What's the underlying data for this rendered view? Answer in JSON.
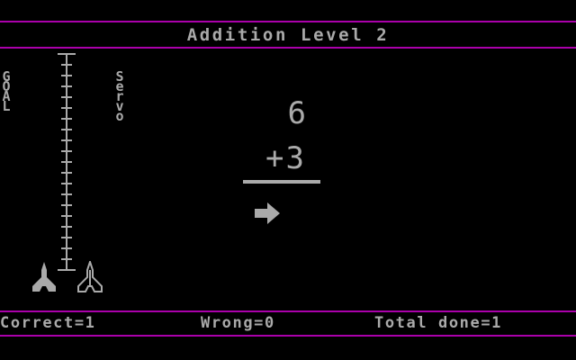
{
  "header": {
    "title": "Addition Level 2"
  },
  "gauge": {
    "goal_label": "GOAL",
    "servo_label": "Servo",
    "tick_count": 20
  },
  "problem": {
    "operand_top": "6",
    "operand_bottom": "+3",
    "answer_prompt": "arrow-right-icon"
  },
  "status_bar": {
    "correct": "Correct=1",
    "wrong": "Wrong=0",
    "total": "Total done=1"
  },
  "colors": {
    "background": "#000000",
    "border": "#aa00aa",
    "text": "#aaaaaa"
  }
}
